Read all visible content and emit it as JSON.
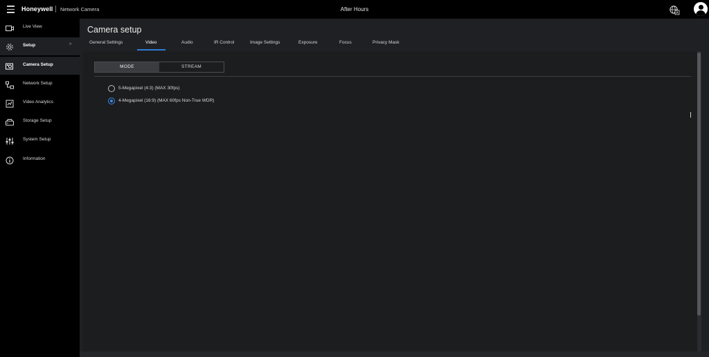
{
  "header": {
    "brand": "Honeywell",
    "product": "Network Camera",
    "mode": "After Hours",
    "icons": [
      "menu-icon",
      "language-icon",
      "user-icon"
    ]
  },
  "sidebar": {
    "items": [
      {
        "label": "Live View",
        "icon": "video-camera-icon"
      },
      {
        "label": "Setup",
        "icon": "gear-icon",
        "expanded": true
      },
      {
        "label": "Camera Setup",
        "icon": "camera-icon",
        "active": true
      },
      {
        "label": "Network Setup",
        "icon": "network-icon"
      },
      {
        "label": "Video Analytics",
        "icon": "analytics-icon"
      },
      {
        "label": "Storage Setup",
        "icon": "storage-icon"
      },
      {
        "label": "System Setup",
        "icon": "sliders-icon"
      },
      {
        "label": "Information",
        "icon": "info-icon"
      }
    ]
  },
  "page": {
    "title": "Camera setup",
    "tabs": [
      "General Settings",
      "Video",
      "Audio",
      "IR Control",
      "Image Settings",
      "Exposure",
      "Focus",
      "Privacy Mask"
    ],
    "active_tab": "Video"
  },
  "video": {
    "segments": [
      "MODE",
      "STREAM"
    ],
    "active_segment": "MODE",
    "options": [
      {
        "label": "5-Megapixel (4:3) (MAX 30fps)",
        "checked": false
      },
      {
        "label": "4-Megapixel (16:9) (MAX 60fps Non-True WDR)",
        "checked": true
      }
    ]
  },
  "colors": {
    "accent": "#2f7bd8",
    "background": "#1f2023",
    "sidebar": "#000000"
  }
}
